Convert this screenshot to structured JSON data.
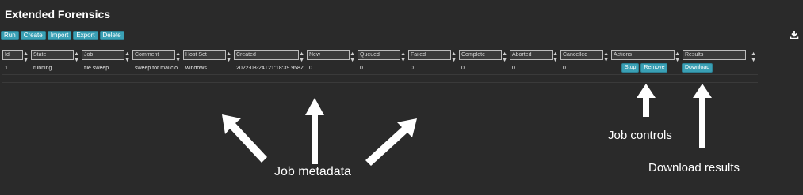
{
  "app": {
    "title": "Extended Forensics"
  },
  "toolbar": {
    "run": "Run",
    "create": "Create",
    "import": "Import",
    "export": "Export",
    "delete": "Delete"
  },
  "columns": [
    "Id",
    "State",
    "Job",
    "Comment",
    "Host Set",
    "Created",
    "New",
    "Queued",
    "Failed",
    "Complete",
    "Aborted",
    "Cancelled",
    "Actions",
    "Results"
  ],
  "rows": [
    {
      "id": "1",
      "state": "running",
      "job": "file sweep",
      "comment": "sweep for malicio...",
      "host_set": "windows",
      "created": "2022-08-24T21:18:39.958Z",
      "new": "0",
      "queued": "0",
      "failed": "0",
      "complete": "0",
      "aborted": "0",
      "cancelled": "0",
      "actions": {
        "stop": "Stop",
        "remove": "Remove"
      },
      "results": {
        "download": "Download"
      }
    }
  ],
  "annotations": {
    "job_metadata": "Job metadata",
    "job_controls": "Job controls",
    "download_results": "Download results"
  },
  "icons": {
    "export_download": "download-icon",
    "sort": "sort-icon"
  },
  "colors": {
    "background": "#2a2a2a",
    "accent": "#3aa0b5"
  }
}
